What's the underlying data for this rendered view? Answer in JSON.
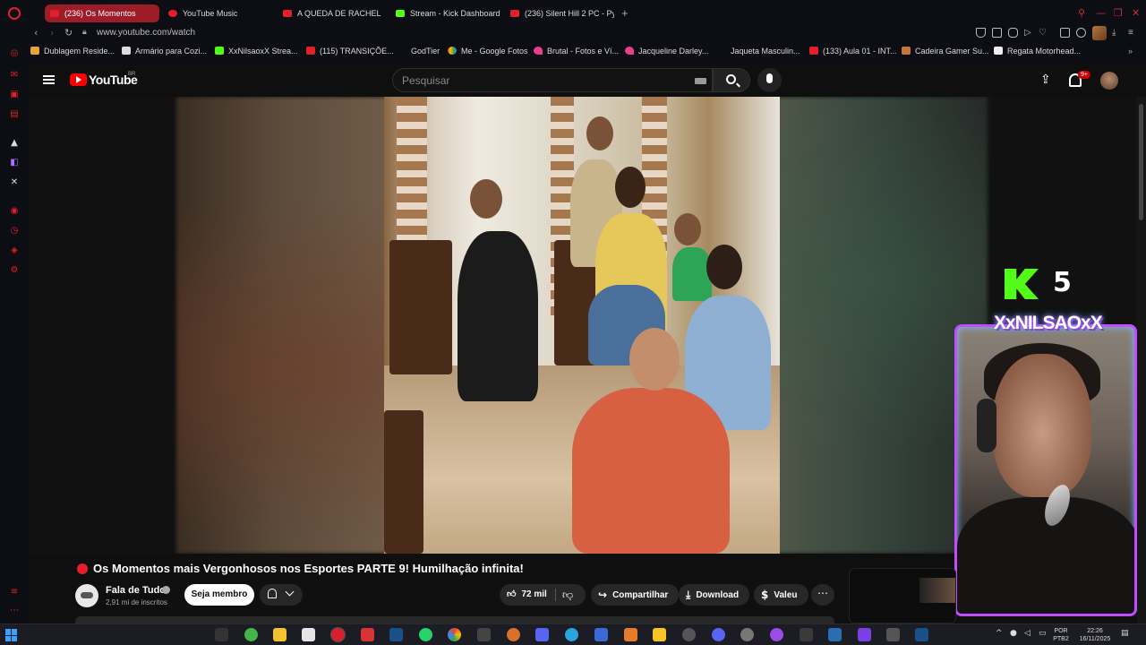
{
  "browser": {
    "tabs": [
      {
        "label": "(236)   Os Momentos",
        "active": true
      },
      {
        "label": "YouTube Music",
        "active": false
      },
      {
        "label": "A QUEDA DE RACHEL SH",
        "active": false
      },
      {
        "label": "Stream - Kick Dashboard",
        "active": false
      },
      {
        "label": "(236) Silent Hill 2 PC - Py",
        "active": false
      }
    ],
    "url": "www.youtube.com/watch",
    "bookmarks": [
      "Dublagem Reside...",
      "Armário para Cozi...",
      "XxNilsaoxX Strea...",
      "(115) TRANSIÇÕE...",
      "GodTier",
      "Me - Google Fotos",
      "Brutal - Fotos e Ví...",
      "Jacqueline Darley...",
      "Jaqueta Masculin...",
      "(133) Aula 01 - INT...",
      "Cadeira Gamer Su...",
      "Regata Motorhead..."
    ]
  },
  "youtube": {
    "logo_text": "YouTube",
    "country": "BR",
    "search_placeholder": "Pesquisar",
    "notifications_badge": "9+"
  },
  "video": {
    "title": "Os Momentos mais Vergonhosos nos Esportes PARTE 9! Humilhação infinita!",
    "channel": "Fala de Tudo",
    "subscribers": "2,91 mi de inscritos",
    "member_label": "Seja membro",
    "likes": "72 mil",
    "share_label": "Compartilhar",
    "download_label": "Download",
    "thanks_label": "Valeu"
  },
  "overlay": {
    "kick_number": "5",
    "streamer_name": "XxNILSAOxX"
  },
  "taskbar": {
    "language": "POR",
    "layout": "PTB2",
    "time": "22:26",
    "date": "16/11/2025"
  },
  "colors": {
    "accent_red": "#e51e2a",
    "kick_green": "#53fc18",
    "opera_red": "#e0202c",
    "webcam_border": "#c44bff"
  }
}
